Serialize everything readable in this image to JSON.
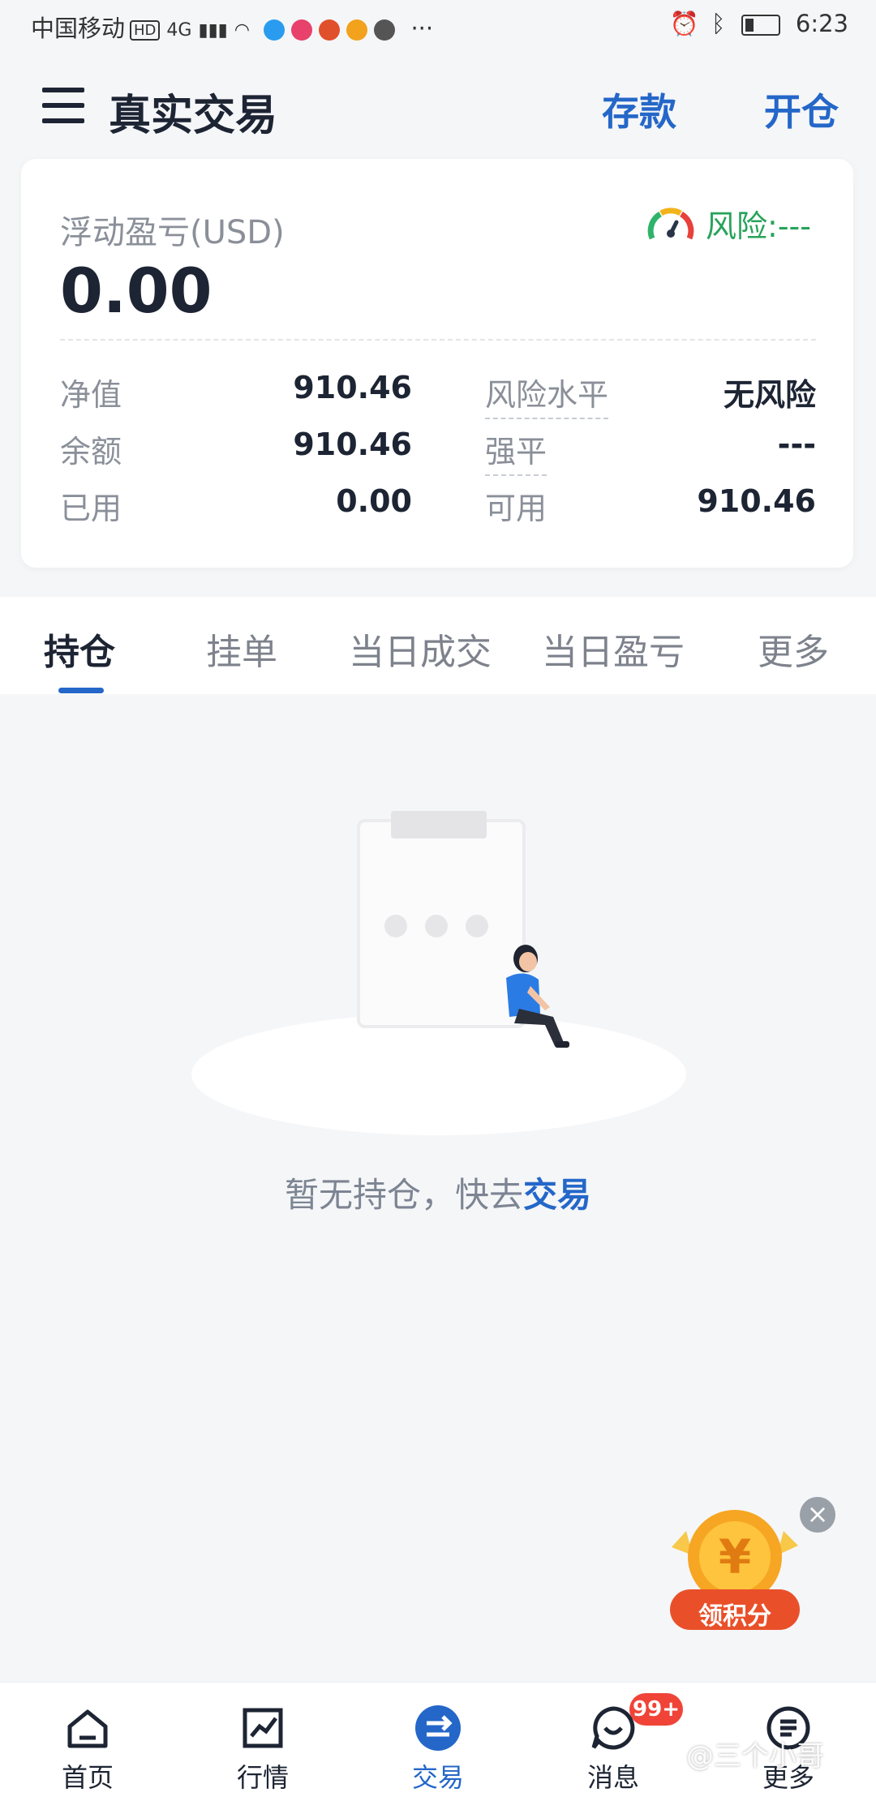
{
  "status_bar": {
    "carrier": "中国移动",
    "hd": "HD",
    "network": "4G",
    "dots": "···",
    "time": "6:23"
  },
  "header": {
    "title": "真实交易",
    "deposit": "存款",
    "open_position": "开仓"
  },
  "account": {
    "floating_pnl_label": "浮动盈亏(USD)",
    "floating_pnl_value": "0.00",
    "risk_label": "风险:---",
    "rows": [
      {
        "label": "净值",
        "value": "910.46",
        "label2": "风险水平",
        "value2": "无风险"
      },
      {
        "label": "余额",
        "value": "910.46",
        "label2": "强平",
        "value2": "---"
      },
      {
        "label": "已用",
        "value": "0.00",
        "label2": "可用",
        "value2": "910.46"
      }
    ]
  },
  "tabs": [
    "持仓",
    "挂单",
    "当日成交",
    "当日盈亏",
    "更多"
  ],
  "empty_state": {
    "text": "暂无持仓，快去",
    "link": "交易"
  },
  "reward": {
    "label": "领积分",
    "currency_symbol": "¥"
  },
  "bottom_nav": {
    "items": [
      {
        "label": "首页",
        "icon": "home-icon"
      },
      {
        "label": "行情",
        "icon": "chart-icon"
      },
      {
        "label": "交易",
        "icon": "exchange-icon"
      },
      {
        "label": "消息",
        "icon": "message-icon"
      },
      {
        "label": "更多",
        "icon": "more-icon"
      }
    ],
    "active": "交易",
    "message_badge": "99+"
  },
  "watermark": "@三个小哥",
  "colors": {
    "accent": "#2467c8",
    "risk_green": "#27a35a",
    "badge_red": "#f04438"
  }
}
